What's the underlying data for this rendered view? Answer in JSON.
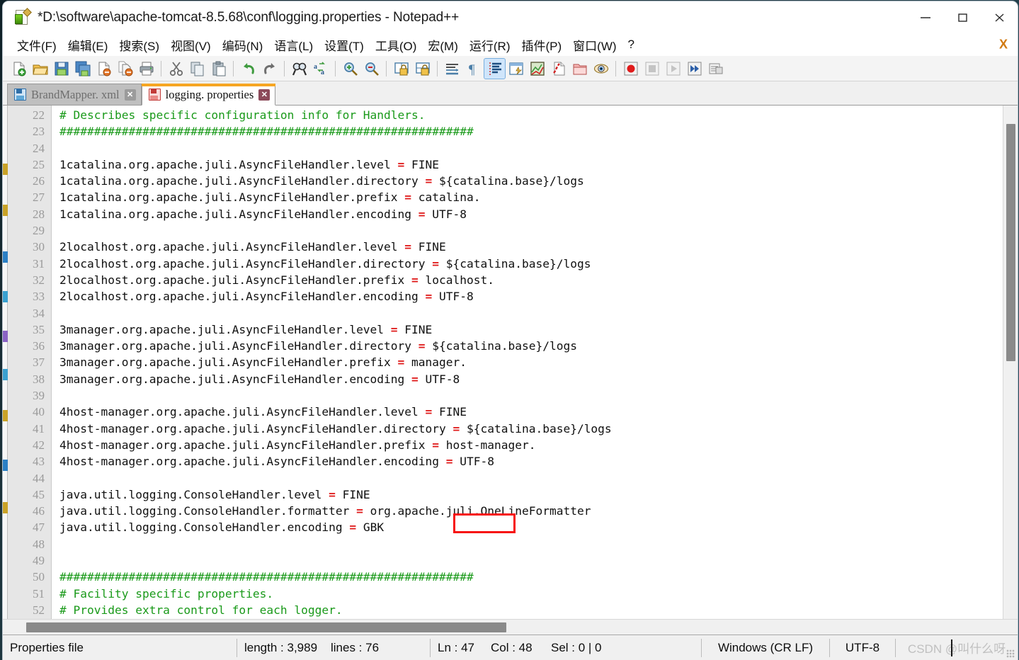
{
  "window": {
    "title": "*D:\\software\\apache-tomcat-8.5.68\\conf\\logging.properties - Notepad++",
    "app_icon": "notepad-plus-plus-icon",
    "controls": {
      "minimize": "minimize-icon",
      "maximize": "maximize-icon",
      "close": "close-icon"
    }
  },
  "menu": {
    "items": [
      {
        "label": "文件(F)",
        "name": "menu-file"
      },
      {
        "label": "编辑(E)",
        "name": "menu-edit"
      },
      {
        "label": "搜索(S)",
        "name": "menu-search"
      },
      {
        "label": "视图(V)",
        "name": "menu-view"
      },
      {
        "label": "编码(N)",
        "name": "menu-encoding"
      },
      {
        "label": "语言(L)",
        "name": "menu-language"
      },
      {
        "label": "设置(T)",
        "name": "menu-settings"
      },
      {
        "label": "工具(O)",
        "name": "menu-tools"
      },
      {
        "label": "宏(M)",
        "name": "menu-macro"
      },
      {
        "label": "运行(R)",
        "name": "menu-run"
      },
      {
        "label": "插件(P)",
        "name": "menu-plugins"
      },
      {
        "label": "窗口(W)",
        "name": "menu-window"
      },
      {
        "label": "?",
        "name": "menu-help"
      }
    ],
    "close_document_label": "X"
  },
  "toolbar": {
    "buttons": [
      "new-file-icon",
      "open-file-icon",
      "save-icon",
      "save-all-icon",
      "close-file-icon",
      "close-all-files-icon",
      "print-icon",
      "cut-icon",
      "copy-icon",
      "paste-icon",
      "undo-icon",
      "redo-icon",
      "find-icon",
      "replace-icon",
      "zoom-in-icon",
      "zoom-out-icon",
      "sync-vertical-scroll-icon",
      "sync-horizontal-scroll-icon",
      "word-wrap-icon",
      "show-all-characters-icon",
      "show-indent-guide-icon",
      "user-defined-language-icon",
      "show-document-map-icon",
      "show-function-list-icon",
      "show-folder-as-workspace-icon",
      "monitoring-icon",
      "start-record-macro-icon",
      "stop-record-macro-icon",
      "play-macro-icon",
      "run-macro-multiple-icon",
      "save-macro-icon"
    ],
    "selected": "show-indent-guide-icon"
  },
  "tabs": [
    {
      "label": "BrandMapper. xml",
      "active": false,
      "modified": false,
      "icon": "save-disk-icon",
      "close": "tab-close-icon"
    },
    {
      "label": "logging. properties",
      "active": true,
      "modified": true,
      "icon": "save-disk-icon",
      "close": "tab-close-icon"
    }
  ],
  "editor": {
    "first_line_number": 22,
    "current_line": 47,
    "colors": {
      "comment": "#1a9a1a",
      "operator": "#e02020",
      "text": "#101010",
      "current_line_highlight": "#e8e8fb",
      "gutter_bg": "#e6e6e6",
      "gutter_fg": "#9a9a9a",
      "annotation_box": "#f71010"
    },
    "lines": [
      {
        "n": 22,
        "segs": [
          {
            "t": "# Describes specific configuration info for Handlers.",
            "c": "cmt"
          }
        ]
      },
      {
        "n": 23,
        "segs": [
          {
            "t": "############################################################",
            "c": "cmt"
          }
        ]
      },
      {
        "n": 24,
        "segs": [
          {
            "t": "",
            "c": "key"
          }
        ]
      },
      {
        "n": 25,
        "segs": [
          {
            "t": "1catalina.org.apache.juli.AsyncFileHandler.level ",
            "c": "key"
          },
          {
            "t": "=",
            "c": "eq"
          },
          {
            "t": " FINE",
            "c": "val"
          }
        ]
      },
      {
        "n": 26,
        "segs": [
          {
            "t": "1catalina.org.apache.juli.AsyncFileHandler.directory ",
            "c": "key"
          },
          {
            "t": "=",
            "c": "eq"
          },
          {
            "t": " ${catalina.base}/logs",
            "c": "val"
          }
        ]
      },
      {
        "n": 27,
        "segs": [
          {
            "t": "1catalina.org.apache.juli.AsyncFileHandler.prefix ",
            "c": "key"
          },
          {
            "t": "=",
            "c": "eq"
          },
          {
            "t": " catalina.",
            "c": "val"
          }
        ]
      },
      {
        "n": 28,
        "segs": [
          {
            "t": "1catalina.org.apache.juli.AsyncFileHandler.encoding ",
            "c": "key"
          },
          {
            "t": "=",
            "c": "eq"
          },
          {
            "t": " UTF-8",
            "c": "val"
          }
        ]
      },
      {
        "n": 29,
        "segs": [
          {
            "t": "",
            "c": "key"
          }
        ]
      },
      {
        "n": 30,
        "segs": [
          {
            "t": "2localhost.org.apache.juli.AsyncFileHandler.level ",
            "c": "key"
          },
          {
            "t": "=",
            "c": "eq"
          },
          {
            "t": " FINE",
            "c": "val"
          }
        ]
      },
      {
        "n": 31,
        "segs": [
          {
            "t": "2localhost.org.apache.juli.AsyncFileHandler.directory ",
            "c": "key"
          },
          {
            "t": "=",
            "c": "eq"
          },
          {
            "t": " ${catalina.base}/logs",
            "c": "val"
          }
        ]
      },
      {
        "n": 32,
        "segs": [
          {
            "t": "2localhost.org.apache.juli.AsyncFileHandler.prefix ",
            "c": "key"
          },
          {
            "t": "=",
            "c": "eq"
          },
          {
            "t": " localhost.",
            "c": "val"
          }
        ]
      },
      {
        "n": 33,
        "segs": [
          {
            "t": "2localhost.org.apache.juli.AsyncFileHandler.encoding ",
            "c": "key"
          },
          {
            "t": "=",
            "c": "eq"
          },
          {
            "t": " UTF-8",
            "c": "val"
          }
        ]
      },
      {
        "n": 34,
        "segs": [
          {
            "t": "",
            "c": "key"
          }
        ]
      },
      {
        "n": 35,
        "segs": [
          {
            "t": "3manager.org.apache.juli.AsyncFileHandler.level ",
            "c": "key"
          },
          {
            "t": "=",
            "c": "eq"
          },
          {
            "t": " FINE",
            "c": "val"
          }
        ]
      },
      {
        "n": 36,
        "segs": [
          {
            "t": "3manager.org.apache.juli.AsyncFileHandler.directory ",
            "c": "key"
          },
          {
            "t": "=",
            "c": "eq"
          },
          {
            "t": " ${catalina.base}/logs",
            "c": "val"
          }
        ]
      },
      {
        "n": 37,
        "segs": [
          {
            "t": "3manager.org.apache.juli.AsyncFileHandler.prefix ",
            "c": "key"
          },
          {
            "t": "=",
            "c": "eq"
          },
          {
            "t": " manager.",
            "c": "val"
          }
        ]
      },
      {
        "n": 38,
        "segs": [
          {
            "t": "3manager.org.apache.juli.AsyncFileHandler.encoding ",
            "c": "key"
          },
          {
            "t": "=",
            "c": "eq"
          },
          {
            "t": " UTF-8",
            "c": "val"
          }
        ]
      },
      {
        "n": 39,
        "segs": [
          {
            "t": "",
            "c": "key"
          }
        ]
      },
      {
        "n": 40,
        "segs": [
          {
            "t": "4host-manager.org.apache.juli.AsyncFileHandler.level ",
            "c": "key"
          },
          {
            "t": "=",
            "c": "eq"
          },
          {
            "t": " FINE",
            "c": "val"
          }
        ]
      },
      {
        "n": 41,
        "segs": [
          {
            "t": "4host-manager.org.apache.juli.AsyncFileHandler.directory ",
            "c": "key"
          },
          {
            "t": "=",
            "c": "eq"
          },
          {
            "t": " ${catalina.base}/logs",
            "c": "val"
          }
        ]
      },
      {
        "n": 42,
        "segs": [
          {
            "t": "4host-manager.org.apache.juli.AsyncFileHandler.prefix ",
            "c": "key"
          },
          {
            "t": "=",
            "c": "eq"
          },
          {
            "t": " host-manager.",
            "c": "val"
          }
        ]
      },
      {
        "n": 43,
        "segs": [
          {
            "t": "4host-manager.org.apache.juli.AsyncFileHandler.encoding ",
            "c": "key"
          },
          {
            "t": "=",
            "c": "eq"
          },
          {
            "t": " UTF-8",
            "c": "val"
          }
        ]
      },
      {
        "n": 44,
        "segs": [
          {
            "t": "",
            "c": "key"
          }
        ]
      },
      {
        "n": 45,
        "segs": [
          {
            "t": "java.util.logging.ConsoleHandler.level ",
            "c": "key"
          },
          {
            "t": "=",
            "c": "eq"
          },
          {
            "t": " FINE",
            "c": "val"
          }
        ]
      },
      {
        "n": 46,
        "segs": [
          {
            "t": "java.util.logging.ConsoleHandler.formatter ",
            "c": "key"
          },
          {
            "t": "=",
            "c": "eq"
          },
          {
            "t": " org.apache.juli.OneLineFormatter",
            "c": "val"
          }
        ]
      },
      {
        "n": 47,
        "hl": true,
        "segs": [
          {
            "t": "java.util.logging.ConsoleHandler.encoding ",
            "c": "key"
          },
          {
            "t": "=",
            "c": "eq"
          },
          {
            "t": " GBK",
            "c": "val"
          }
        ]
      },
      {
        "n": 48,
        "segs": [
          {
            "t": "",
            "c": "key"
          }
        ]
      },
      {
        "n": 49,
        "segs": [
          {
            "t": "",
            "c": "key"
          }
        ]
      },
      {
        "n": 50,
        "segs": [
          {
            "t": "############################################################",
            "c": "cmt"
          }
        ]
      },
      {
        "n": 51,
        "segs": [
          {
            "t": "# Facility specific properties.",
            "c": "cmt"
          }
        ]
      },
      {
        "n": 52,
        "segs": [
          {
            "t": "# Provides extra control for each logger.",
            "c": "cmt"
          }
        ]
      }
    ]
  },
  "statusbar": {
    "doc_type": "Properties file",
    "length": "length : 3,989",
    "lines": "lines : 76",
    "ln": "Ln : 47",
    "col": "Col : 48",
    "sel": "Sel : 0 | 0",
    "eol": "Windows (CR LF)",
    "encoding": "UTF-8",
    "watermark": "CSDN @叫什么呀"
  }
}
